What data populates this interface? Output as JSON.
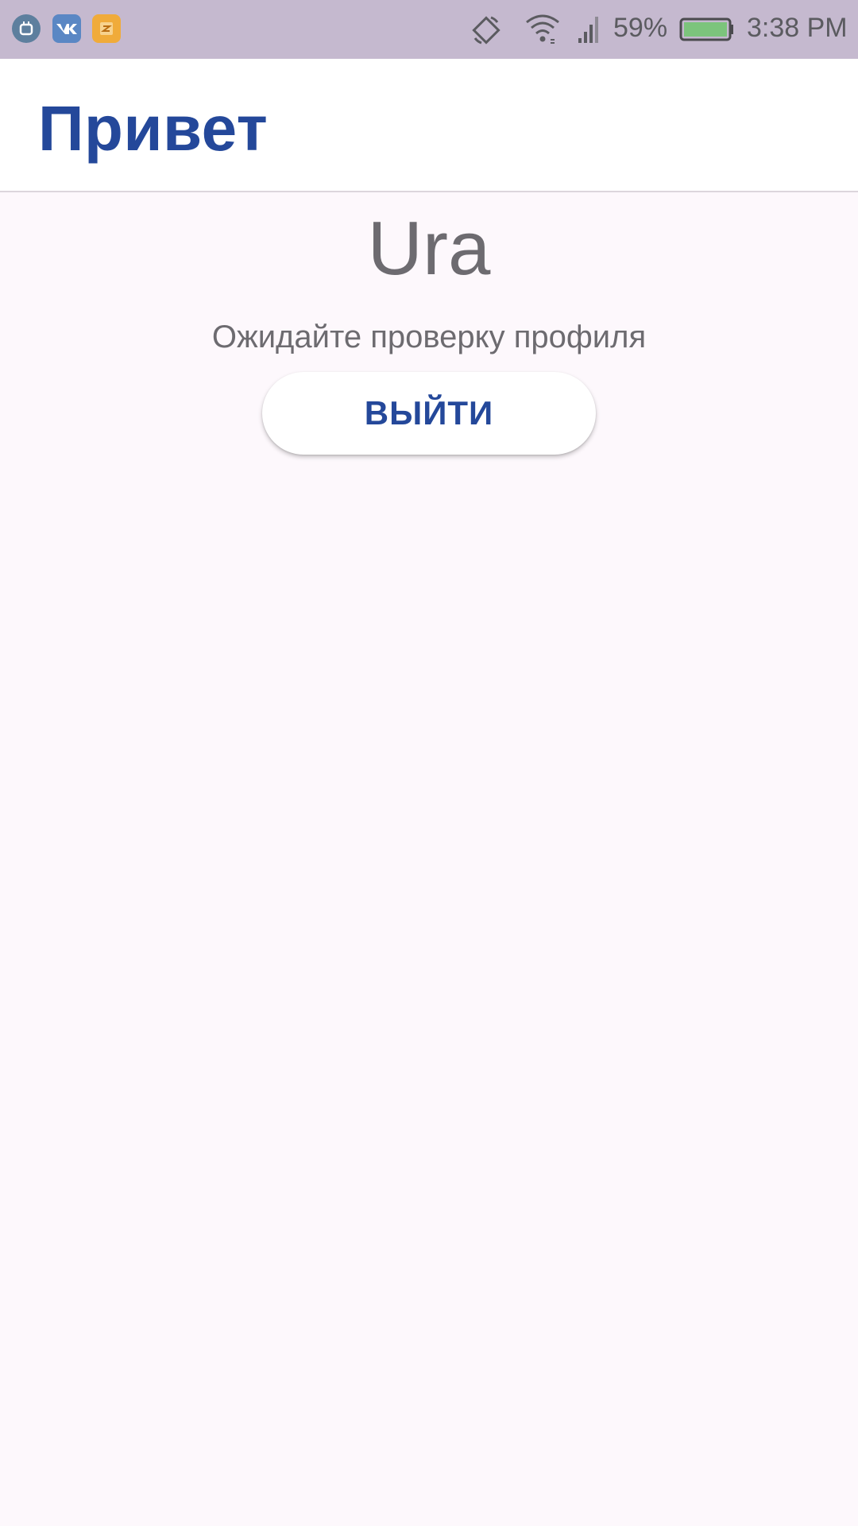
{
  "status_bar": {
    "battery": "59%",
    "time": "3:38 PM",
    "notifications": [
      "android-icon",
      "vk-icon",
      "box-icon"
    ],
    "icons": [
      "rotate-icon",
      "wifi-icon",
      "signal-icon",
      "battery-icon"
    ],
    "colors": {
      "background": "#c5b9cf",
      "battery_fill": "#7cc47c"
    }
  },
  "app_bar": {
    "title": "Привет"
  },
  "main": {
    "user_name": "Ura",
    "status_message": "Ожидайте проверку профиля",
    "logout_label": "ВЫЙТИ"
  },
  "colors": {
    "accent": "#24489a",
    "background": "#fdf8fc",
    "text_secondary": "#6d6b70"
  }
}
